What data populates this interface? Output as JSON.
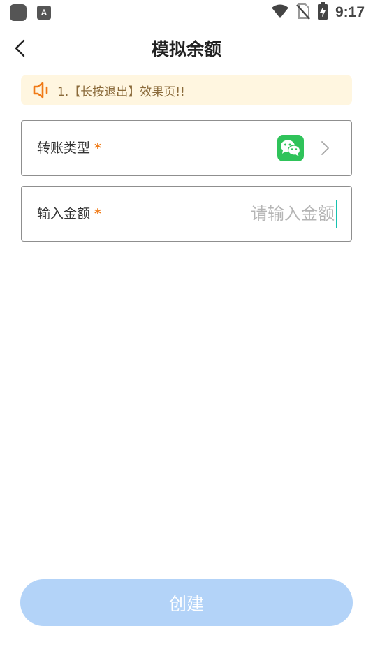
{
  "status_bar": {
    "time": "9:17",
    "icons": [
      "app-icon",
      "a-icon",
      "wifi-icon",
      "no-sim-icon",
      "battery-charging-icon"
    ],
    "a_icon_letter": "A"
  },
  "header": {
    "title": "模拟余额",
    "back_icon": "chevron-left-icon"
  },
  "notice": {
    "icon": "speaker-icon",
    "text": "1.【长按退出】效果页!!",
    "accent_color": "#f07a16",
    "background_color": "#fff6e0"
  },
  "form": {
    "transfer_type": {
      "label": "转账类型",
      "required_mark": "*",
      "selected_icon": "wechat-icon",
      "arrow_icon": "chevron-right-icon"
    },
    "amount": {
      "label": "输入金额",
      "required_mark": "*",
      "value": "",
      "placeholder": "请输入金额"
    }
  },
  "create_button": {
    "label": "创建",
    "color": "#b3d3f8"
  }
}
